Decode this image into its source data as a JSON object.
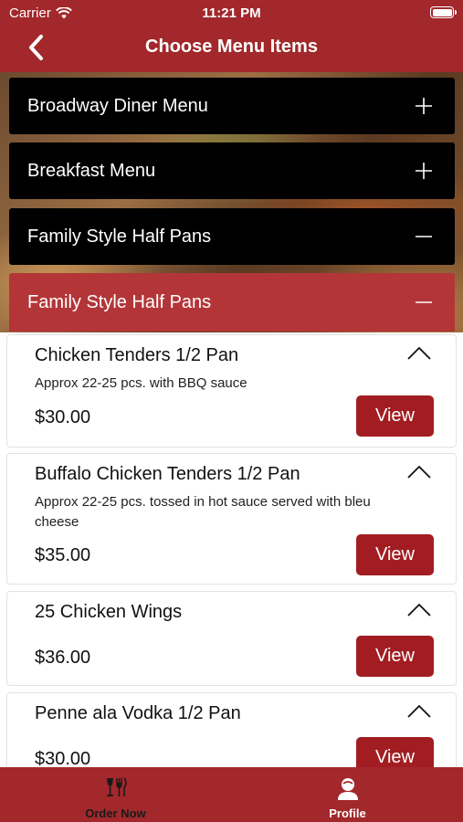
{
  "status": {
    "carrier": "Carrier",
    "time": "11:21 PM"
  },
  "nav": {
    "title": "Choose Menu Items"
  },
  "categories": [
    {
      "label": "Broadway Diner Menu",
      "icon": "plus-icon"
    },
    {
      "label": "Breakfast Menu",
      "icon": "plus-icon"
    },
    {
      "label": "Family Style Half Pans",
      "icon": "minus-icon"
    },
    {
      "label": "Family Style Half Pans",
      "icon": "minus-icon"
    }
  ],
  "items": [
    {
      "name": "Chicken Tenders 1/2 Pan",
      "desc": "Approx 22-25 pcs. with BBQ sauce",
      "price": "$30.00",
      "view": "View"
    },
    {
      "name": "Buffalo Chicken Tenders 1/2 Pan",
      "desc": "Approx 22-25 pcs. tossed in hot sauce served with bleu cheese",
      "price": "$35.00",
      "view": "View"
    },
    {
      "name": "25 Chicken Wings",
      "desc": "",
      "price": "$36.00",
      "view": "View"
    },
    {
      "name": "Penne ala Vodka 1/2 Pan",
      "desc": "",
      "price": "$30.00",
      "view": "View"
    }
  ],
  "tabs": [
    {
      "label": "Order Now",
      "icon": "dining-icon",
      "color": "#1a1a1a"
    },
    {
      "label": "Profile",
      "icon": "user-icon",
      "color": "#ffffff"
    }
  ],
  "colors": {
    "brand": "#a2282b",
    "button": "#a11d22",
    "active_category": "#b43538"
  }
}
